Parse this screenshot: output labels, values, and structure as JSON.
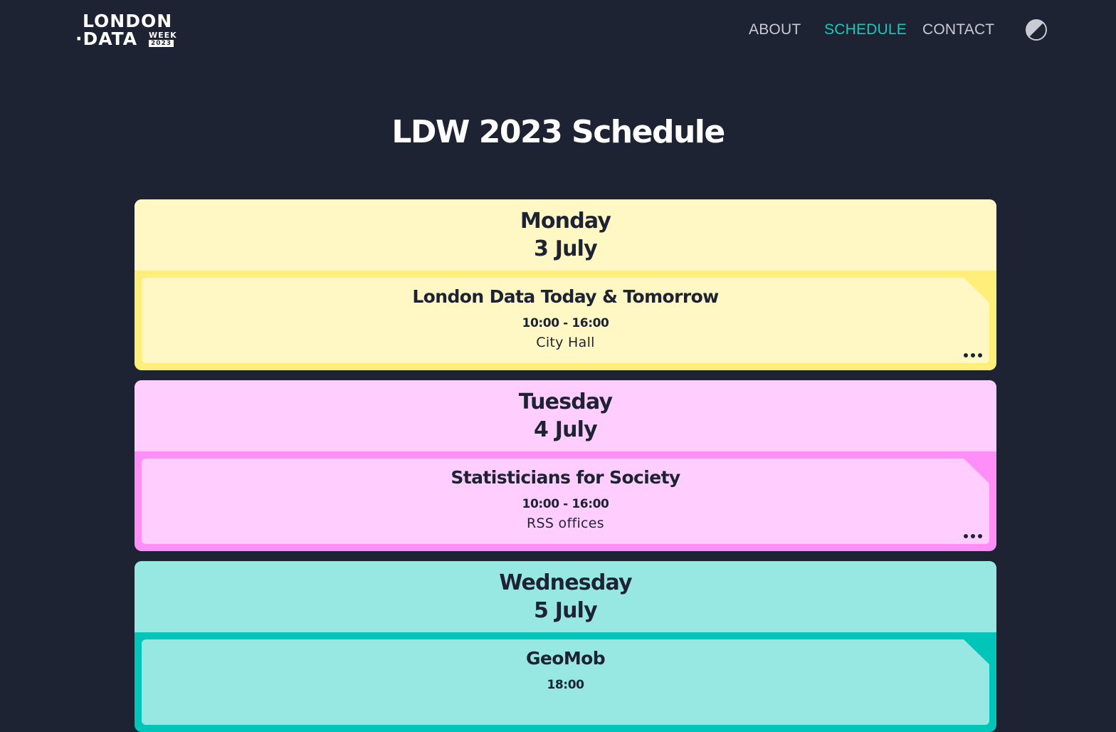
{
  "header": {
    "logo": {
      "line1": "LONDON",
      "line2": "·DATA",
      "line3": "WEEK",
      "line4": "2023"
    },
    "nav": [
      {
        "label": "ABOUT",
        "active": false
      },
      {
        "label": "SCHEDULE",
        "active": true
      },
      {
        "label": "CONTACT",
        "active": false
      }
    ],
    "theme_toggle_icon": "contrast-icon"
  },
  "main": {
    "title": "LDW 2023 Schedule",
    "days": [
      {
        "day": "Monday",
        "date": "3 July",
        "colors": {
          "light": "#fff8c4",
          "accent": "#ffef7a"
        },
        "events": [
          {
            "title": "London Data Today & Tomorrow",
            "time": "10:00 - 16:00",
            "venue": "City Hall"
          }
        ]
      },
      {
        "day": "Tuesday",
        "date": "4 July",
        "colors": {
          "light": "#ffceff",
          "accent": "#ff8ef9"
        },
        "events": [
          {
            "title": "Statisticians for Society",
            "time": "10:00 - 16:00",
            "venue": "RSS offices"
          }
        ]
      },
      {
        "day": "Wednesday",
        "date": "5 July",
        "colors": {
          "light": "#97e8e2",
          "accent": "#00c5b8"
        },
        "events": [
          {
            "title": "GeoMob",
            "time": "18:00",
            "venue": ""
          }
        ]
      }
    ]
  },
  "theme": {
    "background": "#1e2333",
    "nav_active": "#19c8b9",
    "nav_text": "#c8cbd3",
    "text_dark": "#1e2333"
  }
}
